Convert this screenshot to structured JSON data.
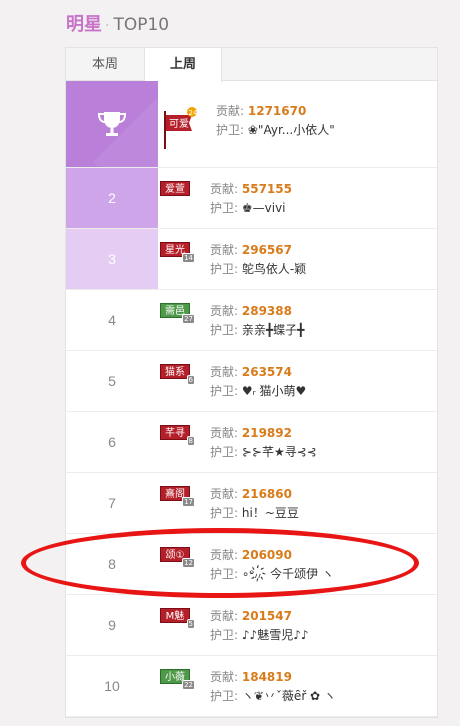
{
  "header": {
    "brand": "明星",
    "dot": "·",
    "title": "TOP10"
  },
  "tabs": [
    {
      "label": "本周",
      "active": false
    },
    {
      "label": "上周",
      "active": true
    }
  ],
  "labels": {
    "contribution": "贡献:",
    "guard": "护卫:"
  },
  "colors": {
    "rank1": "#b97fd9",
    "rank2": "#cfa5ea",
    "rank3": "#e4ccf3",
    "contribution": "#d97b1a",
    "highlight": "#e81515"
  },
  "rows": [
    {
      "rank": "1",
      "rank_icon": "trophy-icon",
      "badge": "可爱",
      "level": "24",
      "contribution": "1271670",
      "guard": "❀\"Ayr...小依人\""
    },
    {
      "rank": "2",
      "badge": "爱萱",
      "level": "",
      "contribution": "557155",
      "guard": "♚—vivi"
    },
    {
      "rank": "3",
      "badge": "星光",
      "level": "14",
      "contribution": "296567",
      "guard": "鸵鸟依人-颖"
    },
    {
      "rank": "4",
      "badge": "需邑",
      "level": "27",
      "contribution": "289388",
      "guard": "亲亲╋蝶子╋"
    },
    {
      "rank": "5",
      "badge": "猫系",
      "level": "6",
      "contribution": "263574",
      "guard": "♥ᵣ 猫小萌♥"
    },
    {
      "rank": "6",
      "badge": "芊寻",
      "level": "8",
      "contribution": "219892",
      "guard": "⊱⊱芊★寻⊰⊰"
    },
    {
      "rank": "7",
      "badge": "熹阁",
      "level": "17",
      "contribution": "216860",
      "guard": "hi！~豆豆"
    },
    {
      "rank": "8",
      "badge": "颂①",
      "level": "12",
      "contribution": "206090",
      "guard": "∘ᵒ៸៸҉ 今千颂伊 ヽ"
    },
    {
      "rank": "9",
      "badge": "M魅",
      "level": "5",
      "contribution": "201547",
      "guard": "♪♪魅雪児♪♪"
    },
    {
      "rank": "10",
      "badge": "小薇",
      "level": "22",
      "contribution": "184819",
      "guard": "ヽ❦丷ˇ薇ȇř ✿ ヽ"
    }
  ]
}
